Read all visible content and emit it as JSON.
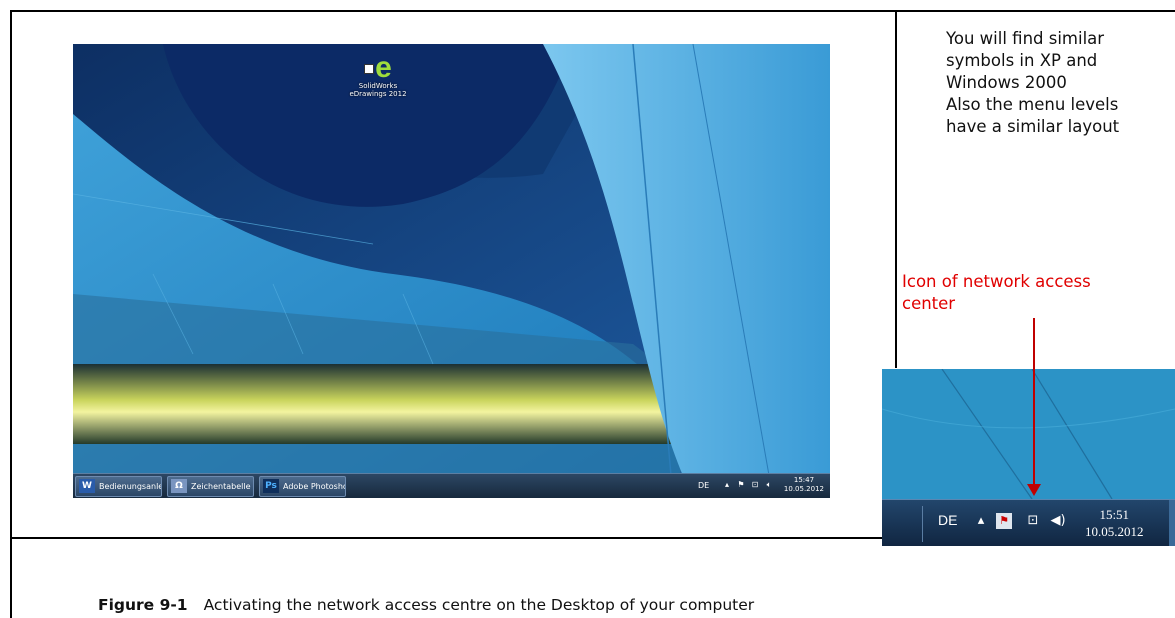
{
  "desktop": {
    "icon_label_line1": "SolidWorks",
    "icon_label_line2": "eDrawings 2012",
    "icon_glyph": "e",
    "taskbar": {
      "buttons": [
        {
          "icon": "W",
          "label": "Bedienungsanleit..."
        },
        {
          "icon": "Ω",
          "label": "Zeichentabelle"
        },
        {
          "icon": "Ps",
          "label": "Adobe Photosho..."
        }
      ],
      "tray_lang": "DE",
      "clock_time": "15:47",
      "clock_date": "10.05.2012"
    }
  },
  "note": {
    "lines": [
      "You will find similar",
      "symbols in XP and",
      "Windows 2000",
      "Also the menu levels",
      "have a similar layout"
    ]
  },
  "callout": {
    "line1": "Icon of network access",
    "line2": "center"
  },
  "zoom_taskbar": {
    "tray_lang": "DE",
    "clock_time": "15:51",
    "clock_date": "10.05.2012"
  },
  "caption": {
    "number": "Figure 9-1",
    "text": "Activating the network access centre on the Desktop of your computer"
  },
  "colors": {
    "callout": "#e00000",
    "arrow": "#c00000"
  }
}
